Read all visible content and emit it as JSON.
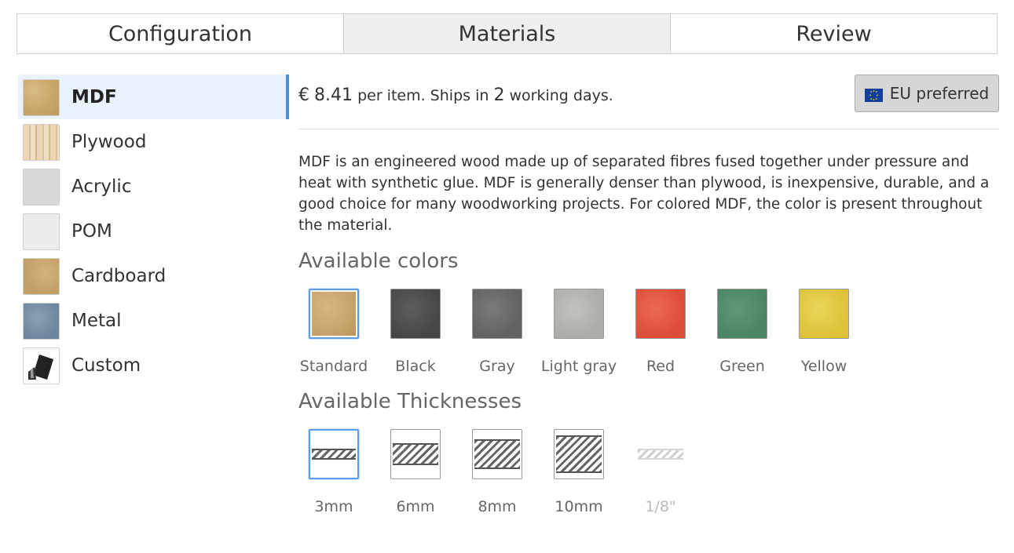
{
  "tabs": [
    {
      "label": "Configuration",
      "active": false
    },
    {
      "label": "Materials",
      "active": true
    },
    {
      "label": "Review",
      "active": false
    }
  ],
  "materials": [
    {
      "label": "MDF",
      "active": true
    },
    {
      "label": "Plywood",
      "active": false
    },
    {
      "label": "Acrylic",
      "active": false
    },
    {
      "label": "POM",
      "active": false
    },
    {
      "label": "Cardboard",
      "active": false
    },
    {
      "label": "Metal",
      "active": false
    },
    {
      "label": "Custom",
      "active": false
    }
  ],
  "price": {
    "currency": "€",
    "amount": "8.41",
    "per_item_text": "per item. Ships in",
    "days": "2",
    "days_text": "working days."
  },
  "eu_button": {
    "label": "EU preferred",
    "icon": "eu-flag-icon"
  },
  "description": "MDF is an engineered wood made up of separated fibres fused together under pressure and heat with synthetic glue. MDF is generally denser than plywood, is inexpensive, durable, and a good choice for many woodworking projects. For colored MDF, the color is present throughout the material.",
  "colors": {
    "title": "Available colors",
    "items": [
      {
        "label": "Standard",
        "hex": "#c8a56c",
        "selected": true
      },
      {
        "label": "Black",
        "hex": "#4a4b49",
        "selected": false
      },
      {
        "label": "Gray",
        "hex": "#666765",
        "selected": false
      },
      {
        "label": "Light gray",
        "hex": "#b3b1ab",
        "selected": false
      },
      {
        "label": "Red",
        "hex": "#e05540",
        "selected": false
      },
      {
        "label": "Green",
        "hex": "#4f8a69",
        "selected": false
      },
      {
        "label": "Yellow",
        "hex": "#e0c840",
        "selected": false
      }
    ]
  },
  "thicknesses": {
    "title": "Available Thicknesses",
    "items": [
      {
        "label": "3mm",
        "selected": true,
        "disabled": false
      },
      {
        "label": "6mm",
        "selected": false,
        "disabled": false
      },
      {
        "label": "8mm",
        "selected": false,
        "disabled": false
      },
      {
        "label": "10mm",
        "selected": false,
        "disabled": false
      },
      {
        "label": "1/8\"",
        "selected": false,
        "disabled": true
      }
    ]
  },
  "accent_color": "#4a90d9"
}
